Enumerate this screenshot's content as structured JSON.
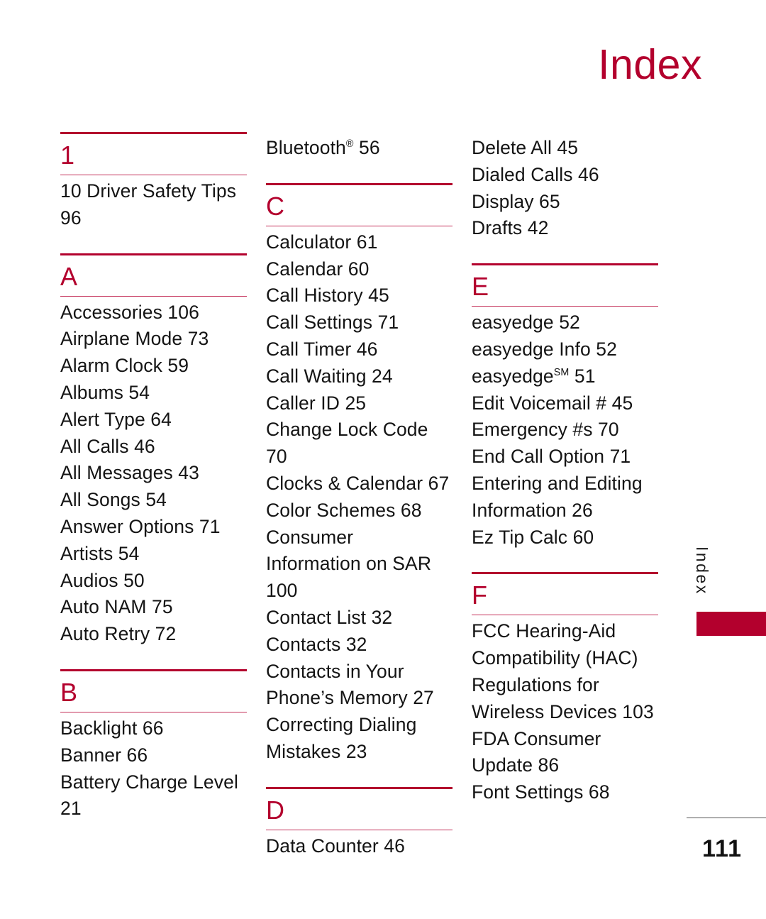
{
  "page": {
    "title": "Index",
    "number": "111",
    "side_tab_label": "Index",
    "accent_color": "#B3002D",
    "rule_color": "#C4315A",
    "text_color": "#141414"
  },
  "columns": [
    {
      "name": "column-1",
      "leadin_entries": [],
      "sections": [
        {
          "letter": "1",
          "entries": [
            "10 Driver Safety Tips 96"
          ]
        },
        {
          "letter": "A",
          "entries": [
            "Accessories 106",
            "Airplane Mode 73",
            "Alarm Clock 59",
            "Albums 54",
            "Alert Type 64",
            "All Calls 46",
            "All Messages 43",
            "All Songs 54",
            "Answer Options 71",
            "Artists 54",
            "Audios 50",
            "Auto NAM 75",
            "Auto Retry 72"
          ]
        },
        {
          "letter": "B",
          "entries": [
            "Backlight 66",
            "Banner 66",
            "Battery Charge Level 21"
          ]
        }
      ]
    },
    {
      "name": "column-2",
      "leadin_entries": [
        "Bluetooth<sup>®</sup> 56"
      ],
      "sections": [
        {
          "letter": "C",
          "entries": [
            "Calculator 61",
            "Calendar 60",
            "Call History 45",
            "Call Settings 71",
            "Call Timer 46",
            "Call Waiting 24",
            "Caller ID 25",
            "Change Lock Code 70",
            "Clocks &amp; Calendar 67",
            "Color Schemes 68",
            "Consumer Information on SAR 100",
            "Contact List 32",
            "Contacts 32",
            "Contacts in Your Phone’s Memory 27",
            "Correcting Dialing Mistakes 23"
          ]
        },
        {
          "letter": "D",
          "entries": [
            "Data Counter 46"
          ]
        }
      ]
    },
    {
      "name": "column-3",
      "leadin_entries": [
        "Delete All 45",
        "Dialed Calls 46",
        "Display 65",
        "Drafts 42"
      ],
      "sections": [
        {
          "letter": "E",
          "entries": [
            "easyedge 52",
            "easyedge Info 52",
            "easyedge<sup>SM</sup> 51",
            "Edit Voicemail # 45",
            "Emergency #s 70",
            "End Call Option 71",
            "Entering and Editing Information 26",
            "Ez Tip Calc 60"
          ]
        },
        {
          "letter": "F",
          "entries": [
            "FCC Hearing-Aid Compatibility (HAC) Regulations for Wireless Devices 103",
            "FDA Consumer Update 86",
            "Font Settings 68"
          ]
        }
      ]
    }
  ]
}
